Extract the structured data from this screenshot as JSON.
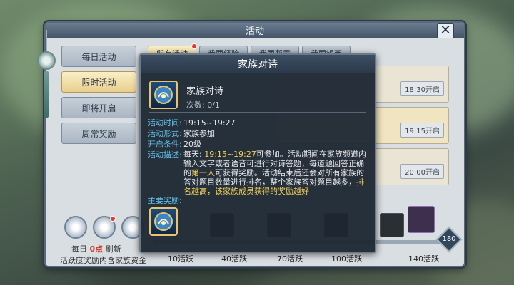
{
  "window": {
    "title": "活动"
  },
  "nav": {
    "items": [
      {
        "label": "每日活动",
        "active": false
      },
      {
        "label": "限时活动",
        "active": true
      },
      {
        "label": "即将开启",
        "active": false
      },
      {
        "label": "周常奖励",
        "active": false
      }
    ]
  },
  "tabs": [
    {
      "label": "所有活动",
      "active": true,
      "has_dot": true
    },
    {
      "label": "我要经验",
      "active": false,
      "has_dot": false
    },
    {
      "label": "我要帮贡",
      "active": false,
      "has_dot": false
    },
    {
      "label": "我要银两",
      "active": false,
      "has_dot": false
    }
  ],
  "list": {
    "rows": [
      {
        "time": "18:30开启",
        "highlight": false
      },
      {
        "time": "19:15开启",
        "highlight": true
      },
      {
        "time": "20:00开启",
        "highlight": false
      }
    ]
  },
  "bottom": {
    "daily_prefix": "每日",
    "daily_time": "0点",
    "daily_suffix": "刷新",
    "hint": "活跃度奖励内含家族资金",
    "levels": [
      "10活跃",
      "40活跃",
      "70活跃",
      "100活跃",
      "140活跃"
    ],
    "max_badge": "180"
  },
  "popup": {
    "title": "家族对诗",
    "name": "家族对诗",
    "count": "次数: 0/1",
    "fields": [
      {
        "key": "活动时间:",
        "value": "19:15~19:27"
      },
      {
        "key": "活动形式:",
        "value": "家族参加"
      },
      {
        "key": "开启条件:",
        "value": "20级"
      }
    ],
    "desc_key": "活动描述:",
    "desc_parts": [
      {
        "text": "每天: ",
        "yellow": false
      },
      {
        "text": "19:15~19:27",
        "yellow": true
      },
      {
        "text": "可参加。活动期间在家族频道内输入文字或者语音可进行对诗答题，每道题回答正确的",
        "yellow": false
      },
      {
        "text": "第一人",
        "yellow": true
      },
      {
        "text": "可获得奖励。活动结束后还会对所有家族的答对题目数量进行排名，整个家族答对题目越多，",
        "yellow": false
      },
      {
        "text": "排名越高，该家族成员获得的奖励越好",
        "yellow": true
      }
    ],
    "reward_label": "主要奖励:"
  },
  "colors": {
    "accent_blue": "#61c0ea",
    "highlight_yellow": "#f0d05a",
    "badge_red": "#e03a2e"
  }
}
